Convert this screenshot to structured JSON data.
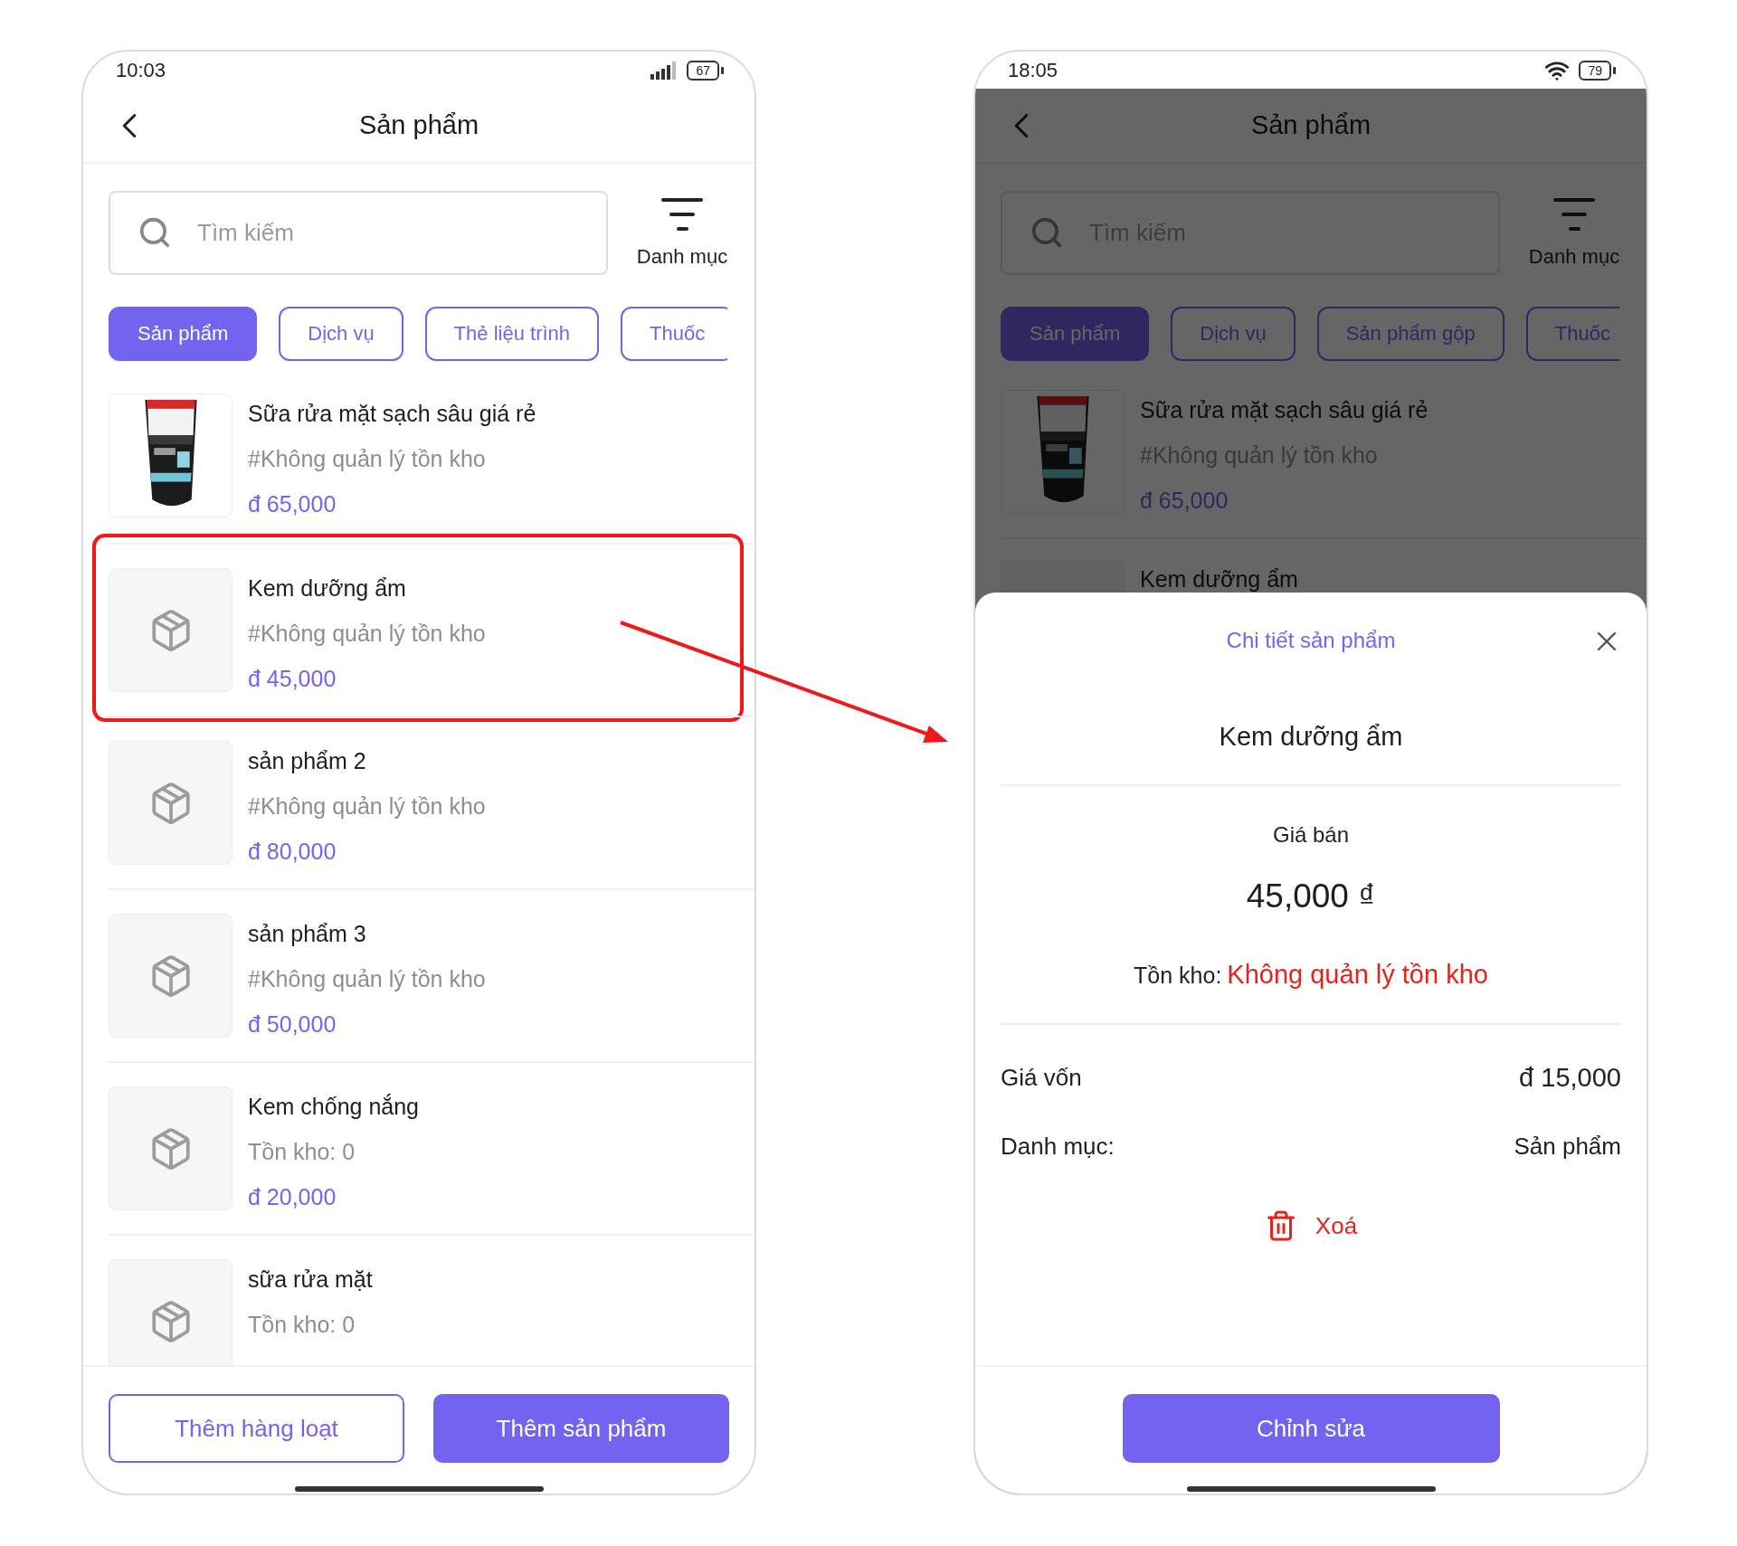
{
  "screens": [
    {
      "status_bar": {
        "time": "10:03",
        "battery": "67"
      },
      "header": {
        "title": "Sản phẩm"
      },
      "search": {
        "placeholder": "Tìm kiếm"
      },
      "category_filter": {
        "label": "Danh mục"
      },
      "tabs": [
        {
          "label": "Sản phẩm",
          "selected": true
        },
        {
          "label": "Dịch vụ",
          "selected": false
        },
        {
          "label": "Thẻ liệu trình",
          "selected": false
        },
        {
          "label": "Thuốc",
          "selected": false
        }
      ],
      "products": [
        {
          "name": "Sữa rửa mặt sạch sâu giá rẻ",
          "stock": "#Không quản lý tồn kho",
          "price": "đ 65,000",
          "kind": "picture",
          "highlighted": false
        },
        {
          "name": "Kem dưỡng ẩm",
          "stock": "#Không quản lý tồn kho",
          "price": "đ 45,000",
          "kind": "placeholder",
          "highlighted": true
        },
        {
          "name": "sản phẩm 2",
          "stock": "#Không quản lý tồn kho",
          "price": "đ 80,000",
          "kind": "placeholder",
          "highlighted": false
        },
        {
          "name": "sản phẩm 3",
          "stock": "#Không quản lý tồn kho",
          "price": "đ 50,000",
          "kind": "placeholder",
          "highlighted": false
        },
        {
          "name": "Kem chống nắng",
          "stock": "Tồn kho: 0",
          "price": "đ 20,000",
          "kind": "placeholder",
          "highlighted": false
        },
        {
          "name": "sữa rửa mặt",
          "stock": "Tồn kho: 0",
          "kind": "placeholder",
          "highlighted": false
        }
      ],
      "footer_buttons": [
        {
          "label": "Thêm hàng loạt",
          "kind": "outline"
        },
        {
          "label": "Thêm sản phẩm",
          "kind": "primary"
        }
      ],
      "dimmed": false
    },
    {
      "status_bar": {
        "time": "18:05",
        "battery": "79"
      },
      "header": {
        "title": "Sản phẩm"
      },
      "search": {
        "placeholder": "Tìm kiếm"
      },
      "category_filter": {
        "label": "Danh mục"
      },
      "tabs": [
        {
          "label": "Sản phẩm",
          "selected": true
        },
        {
          "label": "Dịch vụ",
          "selected": false
        },
        {
          "label": "Sản phẩm gộp",
          "selected": false
        },
        {
          "label": "Thuốc",
          "selected": false
        }
      ],
      "products": [
        {
          "name": "Sữa rửa mặt sạch sâu giá rẻ",
          "stock": "#Không quản lý tồn kho",
          "price": "đ 65,000",
          "kind": "picture",
          "highlighted": false
        },
        {
          "name": "Kem dưỡng ẩm",
          "kind": "placeholder",
          "highlighted": false
        }
      ],
      "dimmed": true,
      "detail_sheet": {
        "title": "Chi tiết sản phẩm",
        "product_name": "Kem dưỡng ẩm",
        "price_label": "Giá bán",
        "price": "45,000 ₫",
        "stock_label": "Tồn kho:",
        "stock_value": "Không quản lý tồn kho",
        "rows": [
          {
            "label": "Giá vốn",
            "value": "đ 15,000"
          },
          {
            "label": "Danh mục:",
            "value": "Sản phẩm"
          }
        ],
        "delete_label": "Xoá",
        "edit_label": "Chỉnh sửa"
      }
    }
  ]
}
